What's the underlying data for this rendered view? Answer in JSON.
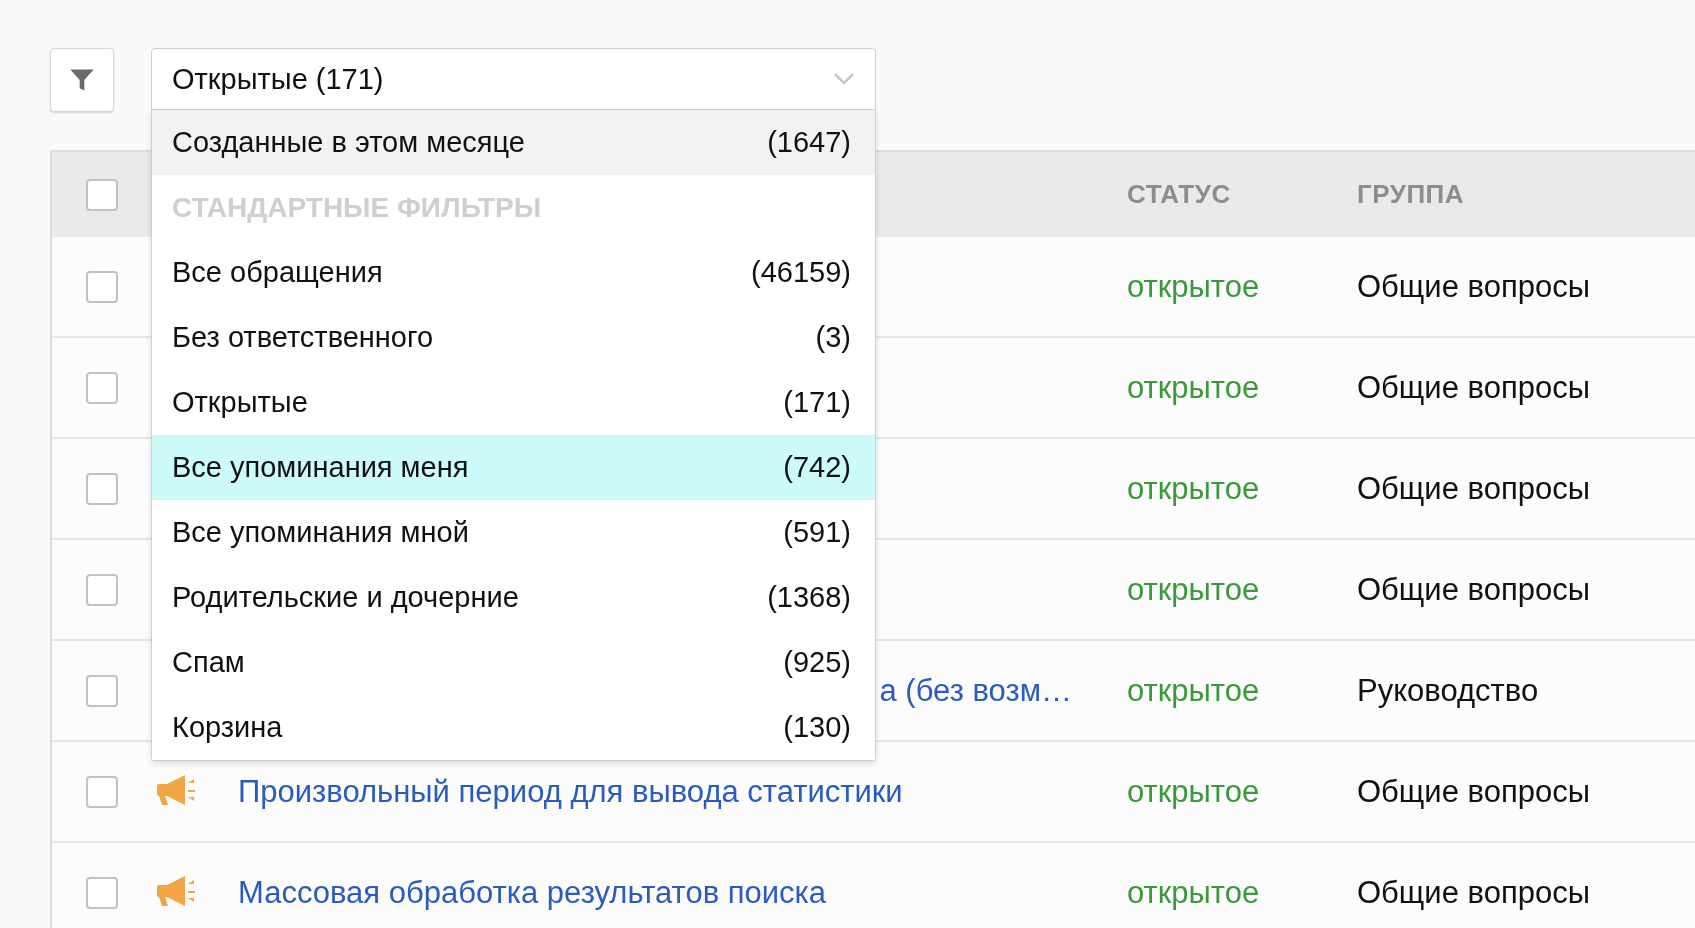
{
  "filter_button": {
    "active": true
  },
  "filter_select": {
    "value": "Открытые (171)",
    "expanded": true,
    "options": [
      {
        "kind": "item",
        "label": "Созданные в этом месяце",
        "count": "(1647)",
        "hovered": true,
        "selected": false
      },
      {
        "kind": "header",
        "label": "СТАНДАРТНЫЕ ФИЛЬТРЫ"
      },
      {
        "kind": "item",
        "label": "Все обращения",
        "count": "(46159)",
        "hovered": false,
        "selected": false
      },
      {
        "kind": "item",
        "label": "Без ответственного",
        "count": "(3)",
        "hovered": false,
        "selected": false
      },
      {
        "kind": "item",
        "label": "Открытые",
        "count": "(171)",
        "hovered": false,
        "selected": false
      },
      {
        "kind": "item",
        "label": "Все упоминания меня",
        "count": "(742)",
        "hovered": false,
        "selected": true
      },
      {
        "kind": "item",
        "label": "Все упоминания мной",
        "count": "(591)",
        "hovered": false,
        "selected": false
      },
      {
        "kind": "item",
        "label": "Родительские и дочерние",
        "count": "(1368)",
        "hovered": false,
        "selected": false
      },
      {
        "kind": "item",
        "label": "Спам",
        "count": "(925)",
        "hovered": false,
        "selected": false
      },
      {
        "kind": "item",
        "label": "Корзина",
        "count": "(130)",
        "hovered": false,
        "selected": false
      }
    ]
  },
  "table": {
    "columns": [
      "СТАТУС",
      "ГРУППА"
    ],
    "header_checked": false,
    "rows": [
      {
        "kind": "covered",
        "checked": false,
        "status": "открытое",
        "group": "Общие вопросы"
      },
      {
        "kind": "covered",
        "checked": false,
        "status": "открытое",
        "group": "Общие вопросы"
      },
      {
        "kind": "covered",
        "checked": false,
        "status": "открытое",
        "group": "Общие вопросы"
      },
      {
        "kind": "covered",
        "checked": false,
        "status": "открытое",
        "group": "Общие вопросы"
      },
      {
        "kind": "covered",
        "checked": false,
        "title": "а (без возм…",
        "status": "открытое",
        "group": "Руководство"
      },
      {
        "kind": "announcement",
        "checked": false,
        "title": "Произвольный период для вывода статистики",
        "status": "открытое",
        "group": "Общие вопросы"
      },
      {
        "kind": "announcement",
        "checked": false,
        "title": "Массовая обработка результатов поиска",
        "status": "открытое",
        "group": "Общие вопросы"
      }
    ]
  }
}
